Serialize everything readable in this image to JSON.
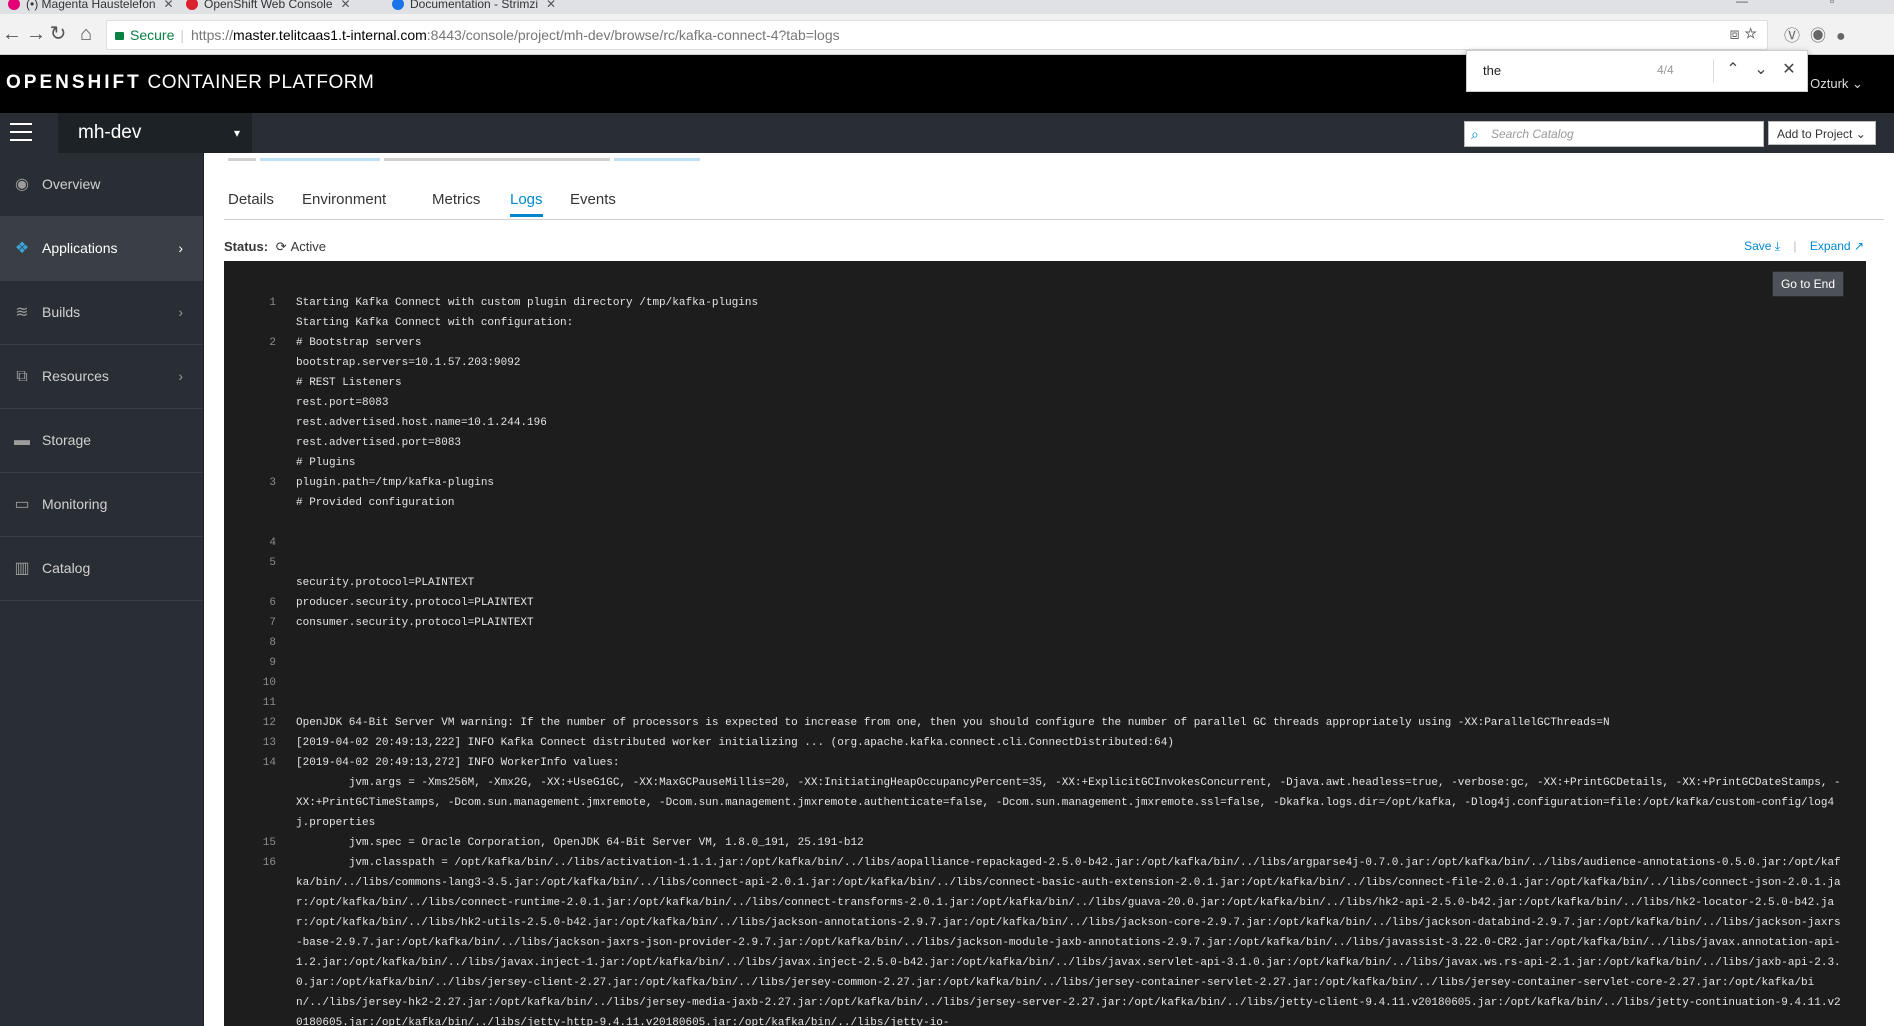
{
  "browser": {
    "tabs": [
      {
        "title": "(•) Magenta Haustelefon",
        "fav_color": "#e20074"
      },
      {
        "title": "OpenShift Web Console",
        "fav_color": "#db212e"
      },
      {
        "title": "Documentation - Strimzi",
        "fav_color": "#1a73e8"
      }
    ],
    "secure_label": "Secure",
    "url_scheme": "https://",
    "url_host": "master.telitcaas1.t-internal.com",
    "url_rest": ":8443/console/project/mh-dev/browse/rc/kafka-connect-4?tab=logs",
    "find": {
      "query": "the",
      "count": "4/4"
    }
  },
  "header": {
    "brand_bold": "OPENSHIFT",
    "brand_rest": "CONTAINER PLATFORM",
    "user": "s Ozturk"
  },
  "subnav": {
    "project": "mh-dev",
    "search_placeholder": "Search Catalog",
    "add_to_project": "Add to Project"
  },
  "sidebar": {
    "items": [
      {
        "label": "Overview",
        "icon": "dashboard-icon",
        "glyph": "◉"
      },
      {
        "label": "Applications",
        "icon": "cubes-icon",
        "glyph": "❖",
        "active": true
      },
      {
        "label": "Builds",
        "icon": "layers-icon",
        "glyph": "≋"
      },
      {
        "label": "Resources",
        "icon": "files-icon",
        "glyph": "⧉"
      },
      {
        "label": "Storage",
        "icon": "storage-icon",
        "glyph": "▬"
      },
      {
        "label": "Monitoring",
        "icon": "monitor-icon",
        "glyph": "▭"
      },
      {
        "label": "Catalog",
        "icon": "book-icon",
        "glyph": "▥"
      }
    ]
  },
  "tabs": [
    "Details",
    "Environment",
    "Metrics",
    "Logs",
    "Events"
  ],
  "active_tab": "Logs",
  "status": {
    "label": "Status:",
    "value": "Active"
  },
  "log_actions": {
    "save": "Save",
    "expand": "Expand"
  },
  "go_to_end": "Go to End",
  "log_lines": [
    {
      "n": "1",
      "t": "Starting Kafka Connect with custom plugin directory /tmp/kafka-plugins"
    },
    {
      "n": "",
      "t": "Starting Kafka Connect with configuration:"
    },
    {
      "n": "2",
      "t": "# Bootstrap servers"
    },
    {
      "n": "",
      "t": "bootstrap.servers=10.1.57.203:9092"
    },
    {
      "n": "",
      "t": "# REST Listeners"
    },
    {
      "n": "",
      "t": "rest.port=8083"
    },
    {
      "n": "",
      "t": "rest.advertised.host.name=10.1.244.196"
    },
    {
      "n": "",
      "t": "rest.advertised.port=8083"
    },
    {
      "n": "",
      "t": "# Plugins"
    },
    {
      "n": "3",
      "t": "plugin.path=/tmp/kafka-plugins"
    },
    {
      "n": "",
      "t": "# Provided configuration"
    },
    {
      "n": "",
      "t": ""
    },
    {
      "n": "4",
      "t": ""
    },
    {
      "n": "5",
      "t": ""
    },
    {
      "n": "",
      "t": "security.protocol=PLAINTEXT"
    },
    {
      "n": "6",
      "t": "producer.security.protocol=PLAINTEXT"
    },
    {
      "n": "7",
      "t": "consumer.security.protocol=PLAINTEXT"
    },
    {
      "n": "8",
      "t": ""
    },
    {
      "n": "9",
      "t": ""
    },
    {
      "n": "10",
      "t": ""
    },
    {
      "n": "11",
      "t": ""
    },
    {
      "n": "12",
      "t": "OpenJDK 64-Bit Server VM warning: If the number of processors is expected to increase from one, then you should configure the number of parallel GC threads appropriately using -XX:ParallelGCThreads=N"
    },
    {
      "n": "13",
      "t": "[2019-04-02 20:49:13,222] INFO Kafka Connect distributed worker initializing ... (org.apache.kafka.connect.cli.ConnectDistributed:64)"
    },
    {
      "n": "14",
      "t": "[2019-04-02 20:49:13,272] INFO WorkerInfo values:"
    },
    {
      "n": "",
      "t": "\tjvm.args = -Xms256M, -Xmx2G, -XX:+UseG1GC, -XX:MaxGCPauseMillis=20, -XX:InitiatingHeapOccupancyPercent=35, -XX:+ExplicitGCInvokesConcurrent, -Djava.awt.headless=true, -verbose:gc, -XX:+PrintGCDetails, -XX:+PrintGCDateStamps, -XX:+PrintGCTimeStamps, -Dcom.sun.management.jmxremote, -Dcom.sun.management.jmxremote.authenticate=false, -Dcom.sun.management.jmxremote.ssl=false, -Dkafka.logs.dir=/opt/kafka, -Dlog4j.configuration=file:/opt/kafka/custom-config/log4j.properties"
    },
    {
      "n": "15",
      "t": "\tjvm.spec = Oracle Corporation, OpenJDK 64-Bit Server VM, 1.8.0_191, 25.191-b12"
    },
    {
      "n": "16",
      "t": "\tjvm.classpath = /opt/kafka/bin/../libs/activation-1.1.1.jar:/opt/kafka/bin/../libs/aopalliance-repackaged-2.5.0-b42.jar:/opt/kafka/bin/../libs/argparse4j-0.7.0.jar:/opt/kafka/bin/../libs/audience-annotations-0.5.0.jar:/opt/kafka/bin/../libs/commons-lang3-3.5.jar:/opt/kafka/bin/../libs/connect-api-2.0.1.jar:/opt/kafka/bin/../libs/connect-basic-auth-extension-2.0.1.jar:/opt/kafka/bin/../libs/connect-file-2.0.1.jar:/opt/kafka/bin/../libs/connect-json-2.0.1.jar:/opt/kafka/bin/../libs/connect-runtime-2.0.1.jar:/opt/kafka/bin/../libs/connect-transforms-2.0.1.jar:/opt/kafka/bin/../libs/guava-20.0.jar:/opt/kafka/bin/../libs/hk2-api-2.5.0-b42.jar:/opt/kafka/bin/../libs/hk2-locator-2.5.0-b42.jar:/opt/kafka/bin/../libs/hk2-utils-2.5.0-b42.jar:/opt/kafka/bin/../libs/jackson-annotations-2.9.7.jar:/opt/kafka/bin/../libs/jackson-core-2.9.7.jar:/opt/kafka/bin/../libs/jackson-databind-2.9.7.jar:/opt/kafka/bin/../libs/jackson-jaxrs-base-2.9.7.jar:/opt/kafka/bin/../libs/jackson-jaxrs-json-provider-2.9.7.jar:/opt/kafka/bin/../libs/jackson-module-jaxb-annotations-2.9.7.jar:/opt/kafka/bin/../libs/javassist-3.22.0-CR2.jar:/opt/kafka/bin/../libs/javax.annotation-api-1.2.jar:/opt/kafka/bin/../libs/javax.inject-1.jar:/opt/kafka/bin/../libs/javax.inject-2.5.0-b42.jar:/opt/kafka/bin/../libs/javax.servlet-api-3.1.0.jar:/opt/kafka/bin/../libs/javax.ws.rs-api-2.1.jar:/opt/kafka/bin/../libs/jaxb-api-2.3.0.jar:/opt/kafka/bin/../libs/jersey-client-2.27.jar:/opt/kafka/bin/../libs/jersey-common-2.27.jar:/opt/kafka/bin/../libs/jersey-container-servlet-2.27.jar:/opt/kafka/bin/../libs/jersey-container-servlet-core-2.27.jar:/opt/kafka/bin/../libs/jersey-hk2-2.27.jar:/opt/kafka/bin/../libs/jersey-media-jaxb-2.27.jar:/opt/kafka/bin/../libs/jersey-server-2.27.jar:/opt/kafka/bin/../libs/jetty-client-9.4.11.v20180605.jar:/opt/kafka/bin/../libs/jetty-continuation-9.4.11.v20180605.jar:/opt/kafka/bin/../libs/jetty-http-9.4.11.v20180605.jar:/opt/kafka/bin/../libs/jetty-io-"
    }
  ]
}
